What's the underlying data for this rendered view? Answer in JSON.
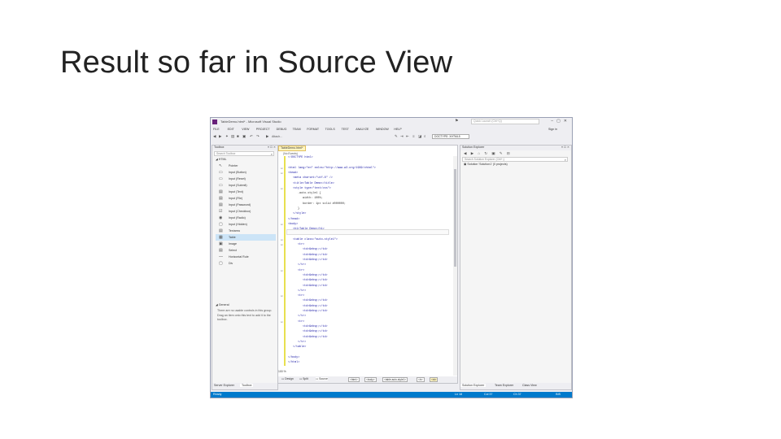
{
  "slide": {
    "title": "Result so far in Source View"
  },
  "window": {
    "title": "TableDemo.html* - Microsoft Visual Studio",
    "quick_launch": "Quick Launch (Ctrl+Q)",
    "sign_in": "Sign in",
    "menu": [
      "FILE",
      "EDIT",
      "VIEW",
      "PROJECT",
      "DEBUG",
      "TEAM",
      "FORMAT",
      "TOOLS",
      "TEST",
      "ANALYZE",
      "WINDOW",
      "HELP"
    ],
    "toolbar": {
      "attach": "Attach...",
      "doctype": "DOCTYPE: XHTML5"
    }
  },
  "toolbox": {
    "header": "Toolbox",
    "search_placeholder": "Search Toolbox",
    "group_html": "◢ HTML",
    "items": [
      {
        "icon": "↖",
        "label": "Pointer"
      },
      {
        "icon": "▭",
        "label": "Input (Button)"
      },
      {
        "icon": "▭",
        "label": "Input (Reset)"
      },
      {
        "icon": "▭",
        "label": "Input (Submit)"
      },
      {
        "icon": "▤",
        "label": "Input (Text)"
      },
      {
        "icon": "▤",
        "label": "Input (File)"
      },
      {
        "icon": "▤",
        "label": "Input (Password)"
      },
      {
        "icon": "☑",
        "label": "Input (Checkbox)"
      },
      {
        "icon": "◉",
        "label": "Input (Radio)"
      },
      {
        "icon": "▢",
        "label": "Input (Hidden)"
      },
      {
        "icon": "▤",
        "label": "Textarea"
      },
      {
        "icon": "▦",
        "label": "Table"
      },
      {
        "icon": "▣",
        "label": "Image"
      },
      {
        "icon": "▤",
        "label": "Select"
      },
      {
        "icon": "—",
        "label": "Horizontal Rule"
      },
      {
        "icon": "▢",
        "label": "Div"
      }
    ],
    "group_general": "◢ General",
    "general_msg": "There are no usable controls in this group. Drag an item onto this text to add it to the toolbox.",
    "bottom_tabs": [
      "Server Explorer",
      "Toolbox"
    ]
  },
  "editor": {
    "tab": "TableDemo.html*",
    "crumb": "(No Events)",
    "code": [
      {
        "t": "<!DOCTYPE html>",
        "i": 0
      },
      {
        "t": "",
        "i": 0
      },
      {
        "t": "<html lang=\"en\" xmlns=\"http://www.w3.org/1999/xhtml\">",
        "i": 0,
        "c": true
      },
      {
        "t": "<head>",
        "i": 0,
        "c": true
      },
      {
        "t": "<meta charset=\"utf-8\" />",
        "i": 1
      },
      {
        "t": "<title>Table Demo</title>",
        "i": 1
      },
      {
        "t": "<style type=\"text/css\">",
        "i": 1,
        "c": true
      },
      {
        "t": ".auto-style1 {",
        "i": 2
      },
      {
        "t": "width: 100%;",
        "i": 3
      },
      {
        "t": "border: 1px solid #000000;",
        "i": 3
      },
      {
        "t": "}",
        "i": 2
      },
      {
        "t": "</style>",
        "i": 1
      },
      {
        "t": "</head>",
        "i": 0
      },
      {
        "t": "<body>",
        "i": 0,
        "c": true
      },
      {
        "t": "<h1>Table Demo</h1>",
        "i": 1
      },
      {
        "t": "",
        "i": 0
      },
      {
        "t": "<table class=\"auto-style1\">",
        "i": 1,
        "c": true
      },
      {
        "t": "<tr>",
        "i": 2,
        "c": true
      },
      {
        "t": "<td>&nbsp;</td>",
        "i": 3
      },
      {
        "t": "<td>&nbsp;</td>",
        "i": 3
      },
      {
        "t": "<td>&nbsp;</td>",
        "i": 3
      },
      {
        "t": "</tr>",
        "i": 2
      },
      {
        "t": "<tr>",
        "i": 2,
        "c": true
      },
      {
        "t": "<td>&nbsp;</td>",
        "i": 3
      },
      {
        "t": "<td>&nbsp;</td>",
        "i": 3
      },
      {
        "t": "<td>&nbsp;</td>",
        "i": 3
      },
      {
        "t": "</tr>",
        "i": 2
      },
      {
        "t": "<tr>",
        "i": 2,
        "c": true
      },
      {
        "t": "<td>&nbsp;</td>",
        "i": 3
      },
      {
        "t": "<td>&nbsp;</td>",
        "i": 3
      },
      {
        "t": "<td>&nbsp;</td>",
        "i": 3
      },
      {
        "t": "</tr>",
        "i": 2
      },
      {
        "t": "<tr>",
        "i": 2,
        "c": true
      },
      {
        "t": "<td>&nbsp;</td>",
        "i": 3
      },
      {
        "t": "<td>&nbsp;</td>",
        "i": 3
      },
      {
        "t": "<td>&nbsp;</td>",
        "i": 3
      },
      {
        "t": "</tr>",
        "i": 2
      },
      {
        "t": "</table>",
        "i": 1
      },
      {
        "t": "",
        "i": 0
      },
      {
        "t": "</body>",
        "i": 0
      },
      {
        "t": "</html>",
        "i": 0
      }
    ],
    "zoom": "100 %",
    "footer": {
      "design": "Design",
      "split": "Split",
      "source": "Source",
      "tags": [
        "<html>",
        "<body>",
        "<table.auto-style1>",
        "<tr>",
        "<td>"
      ]
    }
  },
  "solution": {
    "header": "Solution Explorer",
    "search_placeholder": "Search Solution Explorer (Ctrl+;)",
    "tree_item": "Solution 'Solution1' (0 projects)",
    "bottom_tabs": [
      "Solution Explorer",
      "Team Explorer",
      "Class View"
    ]
  },
  "status": {
    "ready": "Ready",
    "ln": "Ln 18",
    "col": "Col 37",
    "ch": "Ch 37",
    "ins": "INS"
  },
  "colors": {
    "accent": "#007acc",
    "brand": "#68217a"
  }
}
